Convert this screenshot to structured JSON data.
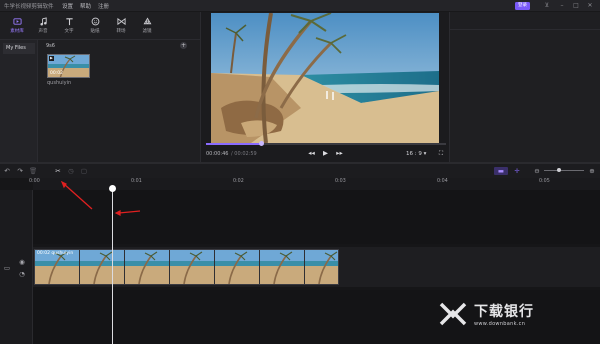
{
  "titlebar": {
    "app_title": "牛学长视频剪辑软件",
    "menu": [
      "设置",
      "帮助",
      "注册"
    ],
    "login_label": "登录"
  },
  "toolbar": {
    "tools": [
      {
        "label": "素材库",
        "icon": "media-library-icon",
        "active": true
      },
      {
        "label": "声音",
        "icon": "music-note-icon",
        "active": false
      },
      {
        "label": "文字",
        "icon": "text-icon",
        "active": false
      },
      {
        "label": "贴纸",
        "icon": "sticker-icon",
        "active": false
      },
      {
        "label": "转场",
        "icon": "transition-icon",
        "active": false
      },
      {
        "label": "滤镜",
        "icon": "filter-icon",
        "active": false
      }
    ]
  },
  "library": {
    "sidebar_item": "My Files",
    "section_label": "9s6",
    "clip": {
      "duration": "00:02",
      "caption": "qushuiyin"
    }
  },
  "preview": {
    "time_current": "00:00:46",
    "time_total": "/ 00:02:59",
    "progress": 0.23,
    "aspect_ratio": "16 : 9 ▾"
  },
  "timeline": {
    "ruler_labels": [
      "0:00",
      "0:01",
      "0:02",
      "0:03",
      "0:04",
      "0:05"
    ],
    "clip_label": "00:02   qushuiyin"
  },
  "watermark": {
    "brand": "下载银行",
    "url": "www.downbank.cn"
  },
  "colors": {
    "accent": "#8a6bff",
    "annotation": "#e02020"
  }
}
